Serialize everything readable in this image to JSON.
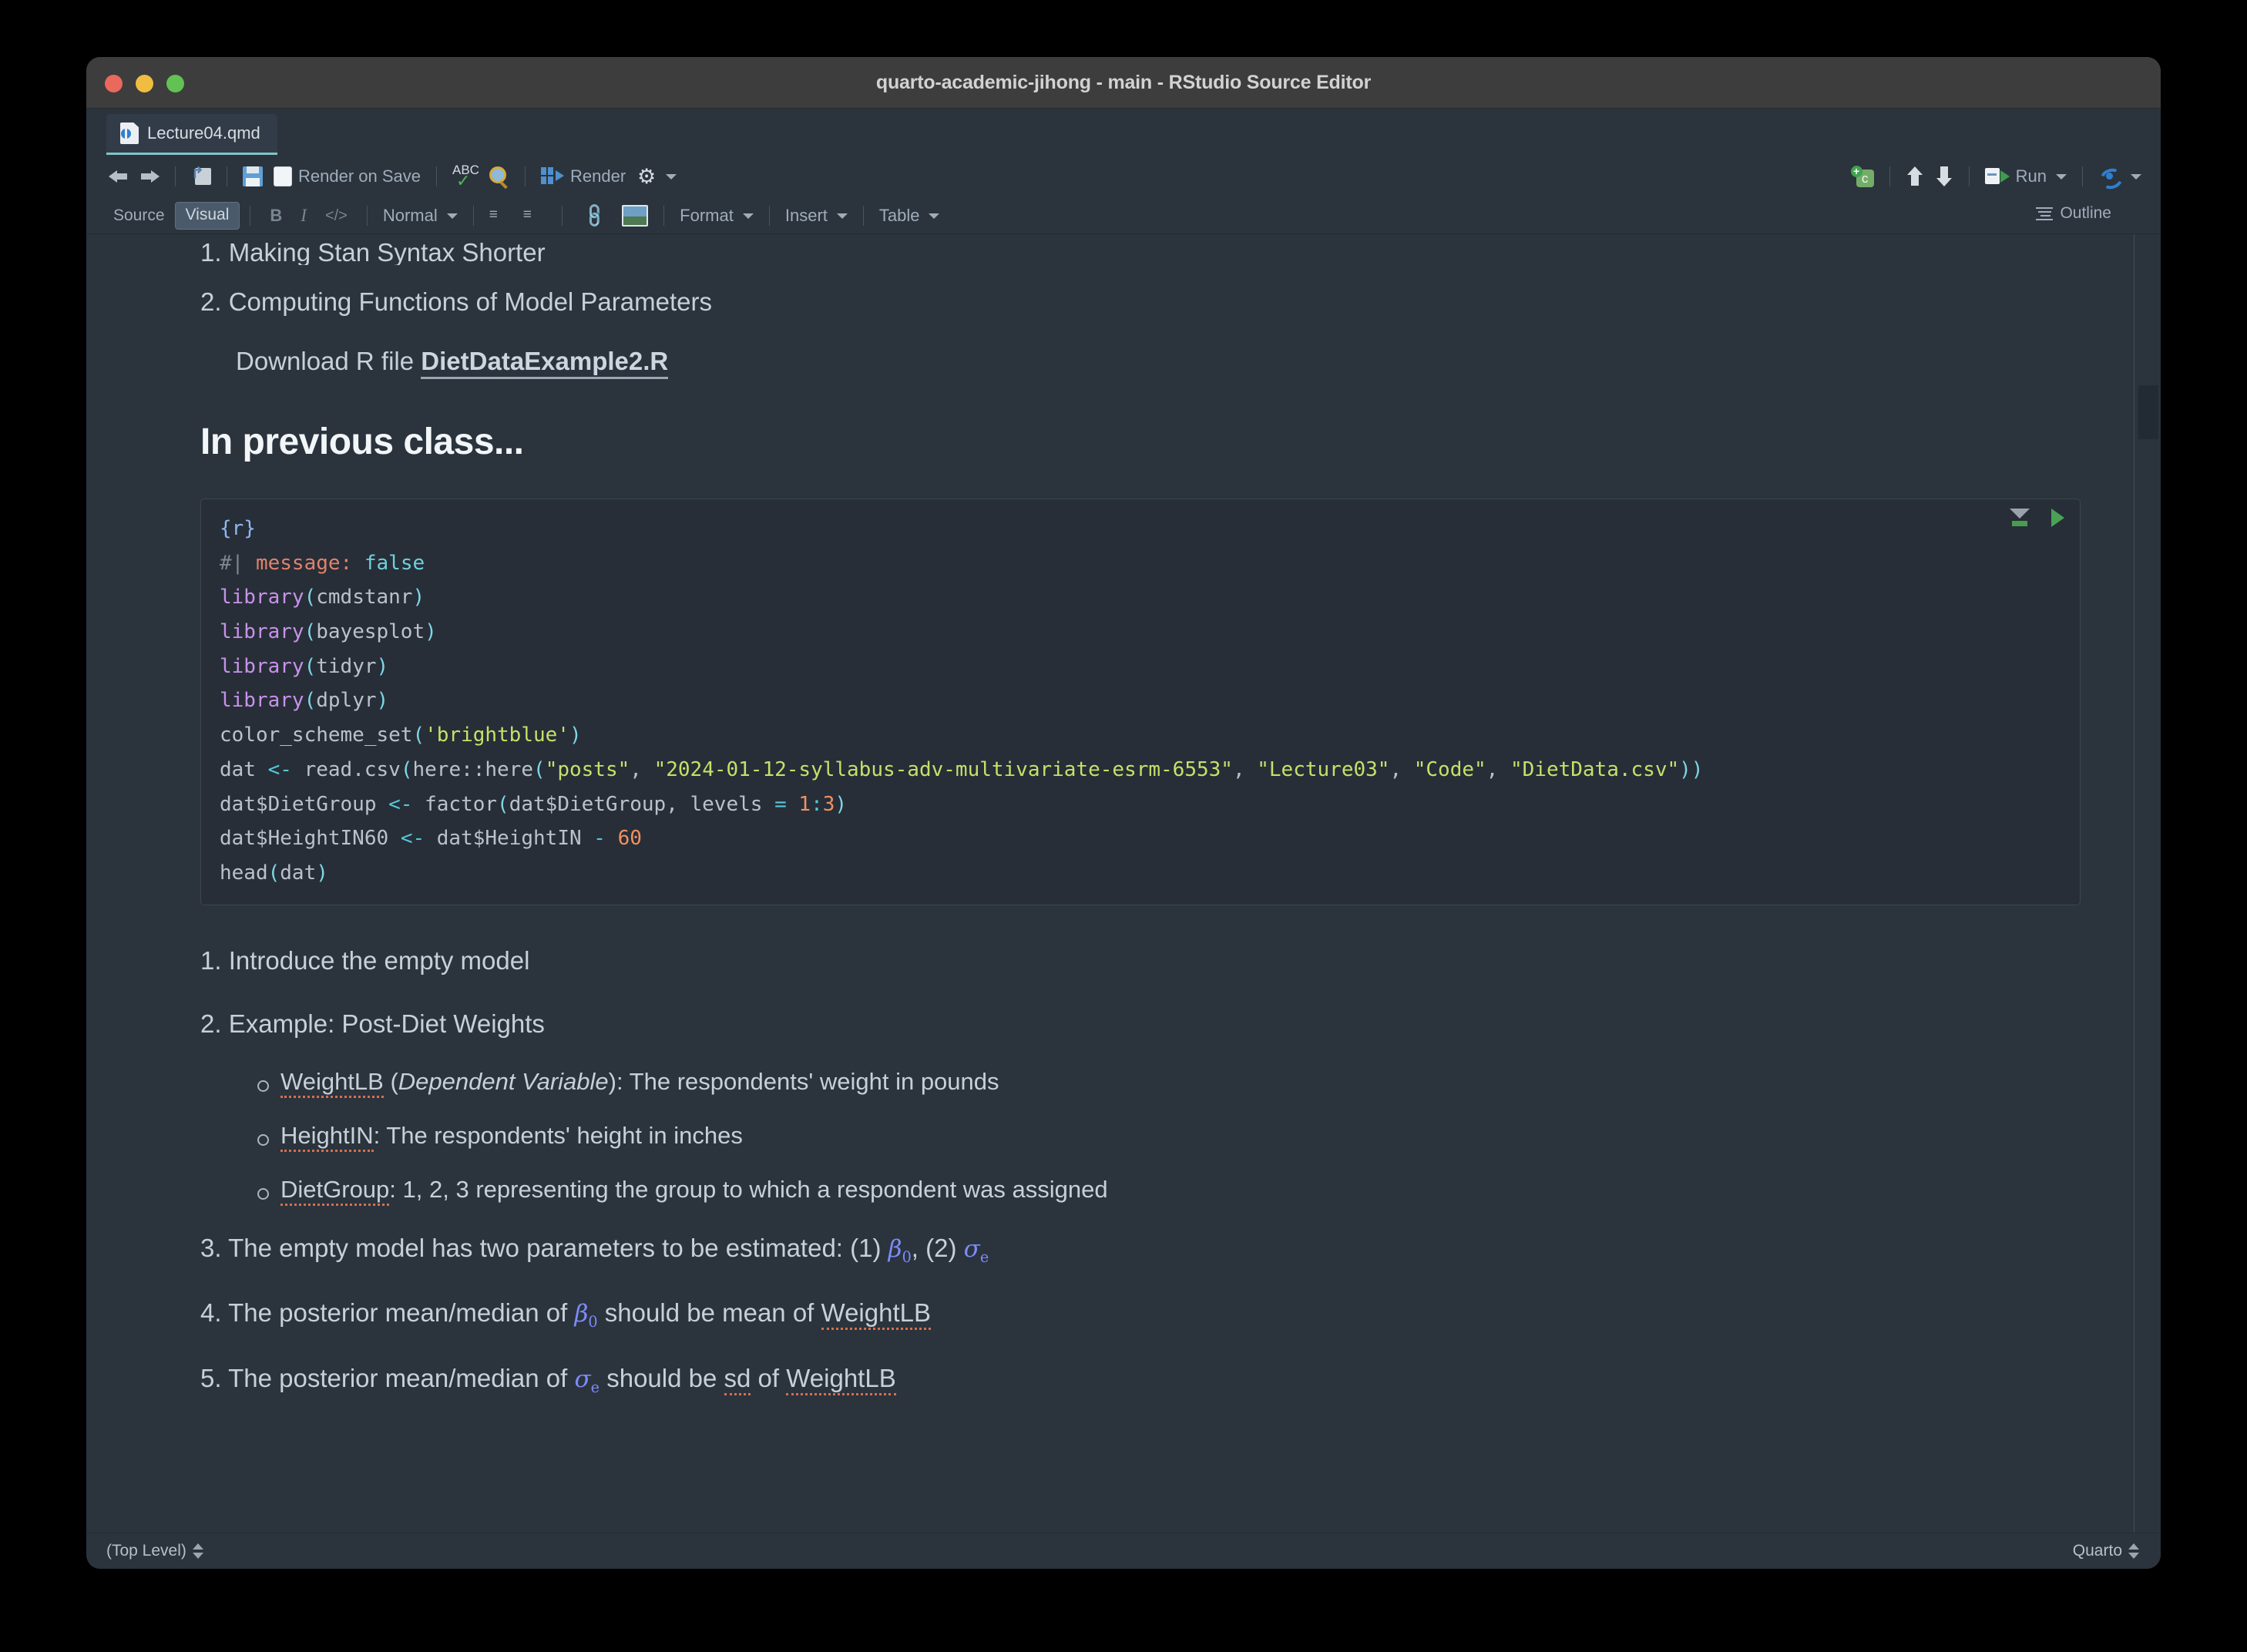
{
  "window": {
    "title": "quarto-academic-jihong - main - RStudio Source Editor"
  },
  "tab": {
    "filename": "Lecture04.qmd",
    "icon": "quarto-document-icon"
  },
  "toolbar_main": {
    "back": "back-arrow",
    "forward": "forward-arrow",
    "popout": "show-in-new-window",
    "save": "save-icon",
    "render_on_save_label": "Render on Save",
    "render_on_save_checked": false,
    "spellcheck": "ABC",
    "find": "find-icon",
    "render_label": "Render",
    "settings": "gear-icon",
    "new_chunk": "C",
    "prev_chunk": "up-arrow",
    "next_chunk": "down-arrow",
    "run_label": "Run",
    "rerun": "resume-icon"
  },
  "toolbar_format": {
    "source_label": "Source",
    "visual_label": "Visual",
    "active_mode": "Visual",
    "bold": "B",
    "italic": "I",
    "code": "</>",
    "block_format": "Normal",
    "bullet_list": "bullet-list-icon",
    "numbered_list": "numbered-list-icon",
    "link": "link-icon",
    "image": "image-icon",
    "format_menu": "Format",
    "insert_menu": "Insert",
    "table_menu": "Table",
    "outline_label": "Outline"
  },
  "document": {
    "clipped_item": "1. Making Stan Syntax Shorter",
    "item2": "2. Computing Functions of Model Parameters",
    "download_prefix": "Download R file",
    "download_link": "DietDataExample2.R",
    "heading": "In previous class...",
    "code_chunk": {
      "engine": "{r}",
      "lines": [
        "#| message: false",
        "library(cmdstanr)",
        "library(bayesplot)",
        "library(tidyr)",
        "library(dplyr)",
        "color_scheme_set('brightblue')",
        "dat <- read.csv(here::here(\"posts\", \"2024-01-12-syllabus-adv-multivariate-esrm-6553\", \"Lecture03\", \"Code\", \"DietData.csv\"))",
        "dat$DietGroup <- factor(dat$DietGroup, levels = 1:3)",
        "dat$HeightIN60 <- dat$HeightIN - 60",
        "head(dat)"
      ],
      "run_above": "run-all-chunks-above",
      "run_chunk": "run-current-chunk"
    },
    "list": [
      {
        "num": "1.",
        "text": "Introduce the empty model"
      },
      {
        "num": "2.",
        "text": "Example: Post-Diet Weights"
      }
    ],
    "sublist": [
      {
        "term": "WeightLB",
        "paren": "Dependent Variable",
        "rest": "The respondents' weight in pounds"
      },
      {
        "term": "HeightIN",
        "rest": "The respondents' height in inches"
      },
      {
        "term": "DietGroup",
        "rest": "1, 2, 3 representing the group to which a respondent was assigned"
      }
    ],
    "item3_pre": "3. The empty model has two parameters to be estimated: (1) ",
    "item3_mid": ", (2) ",
    "item4_pre": "4. The posterior mean/median of ",
    "item4_post": " should be mean of WeightLB",
    "item5_pre": "5. The posterior mean/median of ",
    "item5_post": " should be sd of WeightLB",
    "math_beta": "β",
    "math_beta_sub": "0",
    "math_sigma": "σ",
    "math_sigma_sub": "e"
  },
  "statusbar": {
    "scope": "(Top Level)",
    "doc_type": "Quarto"
  },
  "colors": {
    "window_chrome": "#3d3d3d",
    "editor_bg": "#2b333d",
    "chunk_bg": "#272e37",
    "accent_tab": "#7ec5c9",
    "string": "#c6e06a",
    "function": "#c792ea",
    "number": "#f09060",
    "math": "#7c8cf8",
    "spellcheck": "#d4704f"
  }
}
